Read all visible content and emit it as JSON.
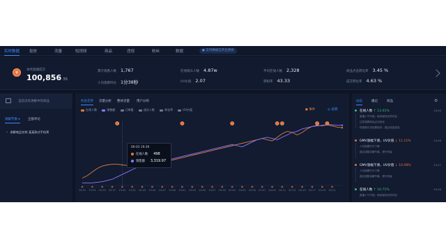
{
  "nav": {
    "tabs": [
      "实时数据",
      "投放",
      "流量",
      "短视频",
      "商品",
      "违规",
      "粉丝",
      "数据"
    ],
    "active_index": 0,
    "pill": "● 实时数据已开启更新"
  },
  "kpi": {
    "main_label": "本场直播成交",
    "main_value": "100,856",
    "main_decimal": ".55",
    "cells": [
      {
        "label": "累计观看人数",
        "value": "1,767"
      },
      {
        "label": "人均观看时长",
        "value": "1分38秒"
      },
      {
        "label": "在线观众人数",
        "value": "4.87w"
      },
      {
        "label": "UV价值",
        "value": "2.07"
      },
      {
        "label": "平均在线人数",
        "value": "2,328"
      },
      {
        "label": "转粉率",
        "value": "43.33"
      },
      {
        "label": "商品点击转化率",
        "value": "3.45 %"
      },
      {
        "label": "成交转化率",
        "value": "4.63 %"
      }
    ],
    "page_dots": 3,
    "page_active": 0
  },
  "left": {
    "header": "当前没有讲解中的商品",
    "seg_on": "讲解节奏 ▾",
    "seg_off": "全部评论",
    "rows": [
      {
        "tag": "•",
        "text": "讲解商品名称 某某款式手机壳"
      }
    ]
  },
  "center": {
    "tabs": [
      "综合走势",
      "流量分析",
      "整体流量",
      "用户分布"
    ],
    "active_tab": 0,
    "legend": [
      {
        "label": "在线人数",
        "color": "#e07a3a"
      },
      {
        "label": "销售额",
        "color": "#8e78ff"
      },
      {
        "label": "订单量",
        "color": "#6f7a92"
      },
      {
        "label": "成交人数",
        "color": "#6f7a92"
      },
      {
        "label": "转化率",
        "color": "#6f7a92"
      },
      {
        "label": "UV价值",
        "color": "#6f7a92"
      }
    ],
    "top_right_warn": "● 事件",
    "top_right_link": "◎ 说明",
    "tooltip": {
      "time": "06-03 19:39",
      "row1_label": "在线人数",
      "row1_value": "498",
      "row2_label": "销售额",
      "row2_value": "3,319.97"
    }
  },
  "chart_data": {
    "type": "line",
    "x": [
      "19:31",
      "19:32",
      "19:33",
      "19:34",
      "19:35",
      "19:36",
      "19:37",
      "19:38",
      "19:39",
      "19:40",
      "19:41",
      "19:42",
      "19:43",
      "19:44",
      "19:45",
      "19:46",
      "19:47",
      "19:48",
      "19:49",
      "19:50",
      "19:51",
      "19:52",
      "19:53",
      "19:54",
      "19:55",
      "19:56",
      "19:57",
      "19:58",
      "19:59",
      "20:00",
      "20:01",
      "20:02",
      "20:03",
      "20:04",
      "20:05",
      "20:06",
      "20:07",
      "20:08",
      "20:09",
      "20:10",
      "20:11",
      "20:12",
      "20:13",
      "20:14",
      "20:15",
      "20:16",
      "20:17",
      "20:18",
      "20:19",
      "20:20",
      "20:21",
      "20:22",
      "20:23"
    ],
    "x_ticks": [
      "19:31",
      "19:33",
      "19:35",
      "19:37",
      "19:39",
      "19:41",
      "19:43",
      "19:45",
      "19:47",
      "19:49",
      "19:51",
      "19:53",
      "19:55",
      "19:57",
      "19:59",
      "20:01",
      "20:03",
      "20:05",
      "20:07",
      "20:09",
      "20:11",
      "20:13",
      "20:15",
      "20:17",
      "20:19",
      "20:21"
    ],
    "series": [
      {
        "name": "在线人数",
        "color": "#e07a3a",
        "values": [
          10,
          14,
          20,
          26,
          30,
          32,
          33,
          33,
          32,
          31,
          30,
          30,
          31,
          32,
          33,
          34,
          36,
          38,
          40,
          42,
          44,
          46,
          48,
          50,
          52,
          54,
          56,
          58,
          60,
          62,
          64,
          66,
          68,
          70,
          72,
          74,
          76,
          74,
          72,
          78,
          84,
          88,
          86,
          82,
          86,
          92,
          96,
          98,
          97,
          99,
          97,
          95,
          94
        ]
      },
      {
        "name": "销售额",
        "color": "#8e78ff",
        "values": [
          2,
          2,
          2,
          3,
          4,
          6,
          8,
          12,
          16,
          20,
          24,
          28,
          30,
          32,
          34,
          36,
          38,
          40,
          42,
          44,
          46,
          48,
          50,
          52,
          54,
          56,
          58,
          60,
          62,
          64,
          66,
          64,
          62,
          66,
          70,
          74,
          76,
          78,
          76,
          74,
          78,
          82,
          86,
          88,
          92,
          94,
          96,
          97,
          98,
          99,
          99,
          98,
          98
        ]
      }
    ],
    "markers": [
      {
        "x": "19:38",
        "series": "在线人数"
      },
      {
        "x": "19:51",
        "series": "在线人数"
      },
      {
        "x": "20:01",
        "series": "在线人数"
      },
      {
        "x": "20:10",
        "series": "在线人数"
      },
      {
        "x": "20:11",
        "series": "在线人数"
      },
      {
        "x": "20:18",
        "series": "在线人数"
      },
      {
        "x": "20:20",
        "series": "在线人数"
      }
    ],
    "ylim": [
      0,
      100
    ],
    "grid": false,
    "legend_position": "top-left"
  },
  "right": {
    "tabs": [
      "动态",
      "播记",
      "商品"
    ],
    "active_tab": 0,
    "events": [
      {
        "title": "在线人数",
        "delta": "↑ 13.41%",
        "dir": "up",
        "time": "19:50",
        "sub": [
          "直播人气不错，继续保持优质内容",
          "注意观察商品点击转化",
          "短视频引流效果较好，建议追加投放"
        ]
      },
      {
        "title": "GMV涨幅下滑，UV价值",
        "delta": "↓ 11.11%",
        "dir": "dn",
        "time": "19:48",
        "sub": [
          "人均观看时长下降",
          "建议调整讲解节奏，提升停留"
        ]
      },
      {
        "title": "GMV涨幅下滑，UV价值",
        "delta": "↓ 10.08%",
        "dir": "dn",
        "time": "19:47",
        "sub": [
          "人均观看时长下降",
          "建议调整讲解节奏，提升停留"
        ]
      },
      {
        "title": "在线人数",
        "delta": "↑ 10.71%",
        "dir": "up",
        "time": "19:46",
        "sub": [
          "直播人气不错，继续保持优质内容"
        ]
      }
    ]
  }
}
